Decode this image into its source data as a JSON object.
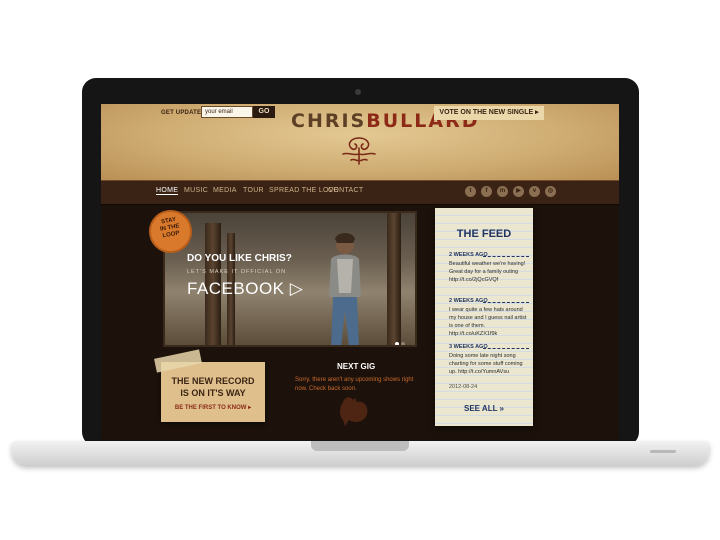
{
  "header": {
    "updates_label": "GET UPDATES",
    "email_placeholder": "your email",
    "go_label": "GO",
    "logo_first": "CHRIS",
    "logo_last": "BULLARD",
    "vote_label": "VOTE ON THE NEW SINGLE ▸"
  },
  "nav": {
    "items": [
      "HOME",
      "MUSIC",
      "MEDIA",
      "TOUR",
      "SPREAD THE LOVE",
      "CONTACT"
    ],
    "active": "HOME",
    "social_icons": [
      "twitter-icon",
      "facebook-icon",
      "myspace-icon",
      "youtube-icon",
      "vimeo-icon",
      "rss-icon"
    ]
  },
  "hero": {
    "badge": [
      "STAY",
      "IN THE",
      "LOOP"
    ],
    "line1": "DO YOU LIKE CHRIS?",
    "line2": "LET'S MAKE IT OFFICIAL ON",
    "line3": "FACEBOOK ▷"
  },
  "record": {
    "line1": "THE NEW RECORD",
    "line2": "IS ON IT'S WAY",
    "link": "BE THE FIRST TO KNOW ▸"
  },
  "gig": {
    "title": "NEXT GIG",
    "text": "Sorry, there aren't any upcoming shows right now. Check back soon."
  },
  "feed": {
    "title": "THE FEED",
    "posts": [
      {
        "when": "2 WEEKS AGO",
        "body": "Beautiful weather we're having! Great day for a family outing http://t.co/2jQcGVQf"
      },
      {
        "when": "2 WEEKS AGO",
        "body": "I wear quite a few hats around my house and I guess nail artist is one of them. http://t.co/uKZX1f9k"
      },
      {
        "when": "3 WEEKS AGO",
        "body": "Doing some late night song charting for some stuff coming up. http://t.co/YumnAVsu"
      }
    ],
    "date": "2012-08-24",
    "see_all": "SEE ALL »"
  },
  "colors": {
    "paper": "#d4b47c",
    "nav_bg": "#3a2214",
    "page_bg": "#1d120b",
    "accent_red": "#8c2a17",
    "feed_blue": "#1f3463",
    "badge_orange": "#d9792b"
  }
}
